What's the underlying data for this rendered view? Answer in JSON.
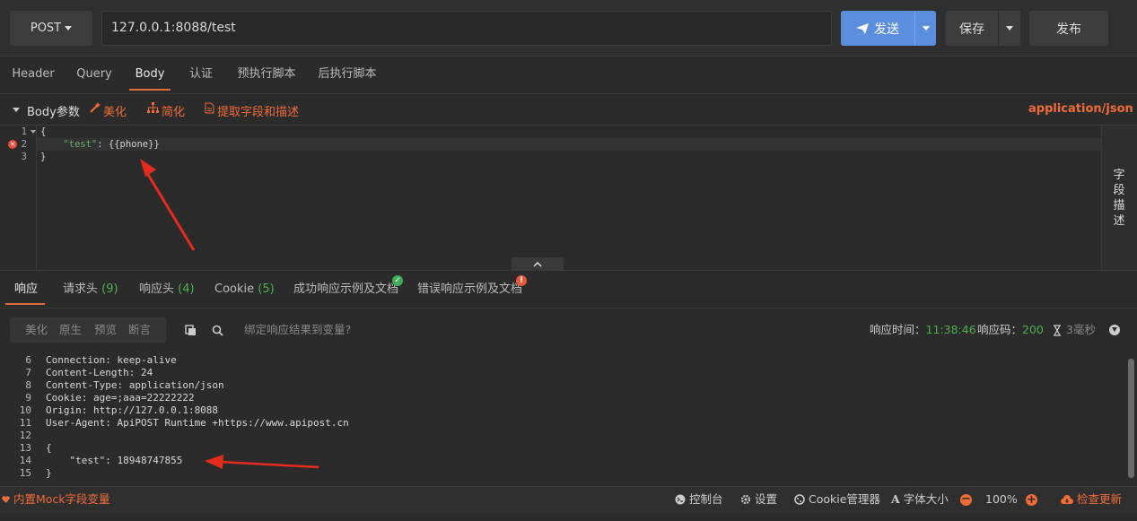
{
  "request": {
    "method": "POST",
    "url": "127.0.0.1:8088/test",
    "send_label": "发送",
    "save_label": "保存",
    "publish_label": "发布"
  },
  "request_tabs": [
    "Header",
    "Query",
    "Body",
    "认证",
    "预执行脚本",
    "后执行脚本"
  ],
  "active_request_tab": "Body",
  "body_toolbar": {
    "title": "Body参数",
    "beautify": "美化",
    "simplify": "简化",
    "extract": "提取字段和描述",
    "content_type": "application/json"
  },
  "editor": {
    "lines": [
      {
        "num": "1",
        "text": "{"
      },
      {
        "num": "2",
        "key": "\"test\"",
        "rest": ": {{phone}}"
      },
      {
        "num": "3",
        "text": "}"
      }
    ]
  },
  "side_panel_label": [
    "字",
    "段",
    "描",
    "述"
  ],
  "response_tabs": [
    {
      "label": "响应",
      "count": ""
    },
    {
      "label": "请求头",
      "count": "(9)"
    },
    {
      "label": "响应头",
      "count": "(4)"
    },
    {
      "label": "Cookie",
      "count": "(5)"
    },
    {
      "label": "成功响应示例及文档",
      "count": ""
    },
    {
      "label": "错误响应示例及文档",
      "count": ""
    }
  ],
  "response_toolbar": {
    "formats": [
      "美化",
      "原生",
      "预览",
      "断言"
    ],
    "bind_label": "绑定响应结果到变量?",
    "time_label": "响应时间：",
    "time_value": "11:38:46",
    "code_label": "响应码：",
    "code_value": "200",
    "duration": "3毫秒"
  },
  "response_lines": [
    {
      "num": "6",
      "text": "Connection: keep-alive"
    },
    {
      "num": "7",
      "text": "Content-Length: 24"
    },
    {
      "num": "8",
      "text": "Content-Type: application/json"
    },
    {
      "num": "9",
      "text": "Cookie: age=;aaa=22222222"
    },
    {
      "num": "10",
      "text": "Origin: http://127.0.0.1:8088"
    },
    {
      "num": "11",
      "text": "User-Agent: ApiPOST Runtime +https://www.apipost.cn"
    },
    {
      "num": "12",
      "text": ""
    },
    {
      "num": "13",
      "text": "{"
    },
    {
      "num": "14",
      "text": "    \"test\": 18948747855"
    },
    {
      "num": "15",
      "text": "}"
    }
  ],
  "status_bar": {
    "mock_label": "内置Mock字段变量",
    "console": "控制台",
    "settings": "设置",
    "cookie_manager": "Cookie管理器",
    "font_size": "字体大小",
    "zoom": "100%",
    "update": "检查更新"
  },
  "colors": {
    "accent": "#ef6c3a",
    "primary": "#5b8fde",
    "success": "#4caf50",
    "error": "#e74c3c"
  }
}
